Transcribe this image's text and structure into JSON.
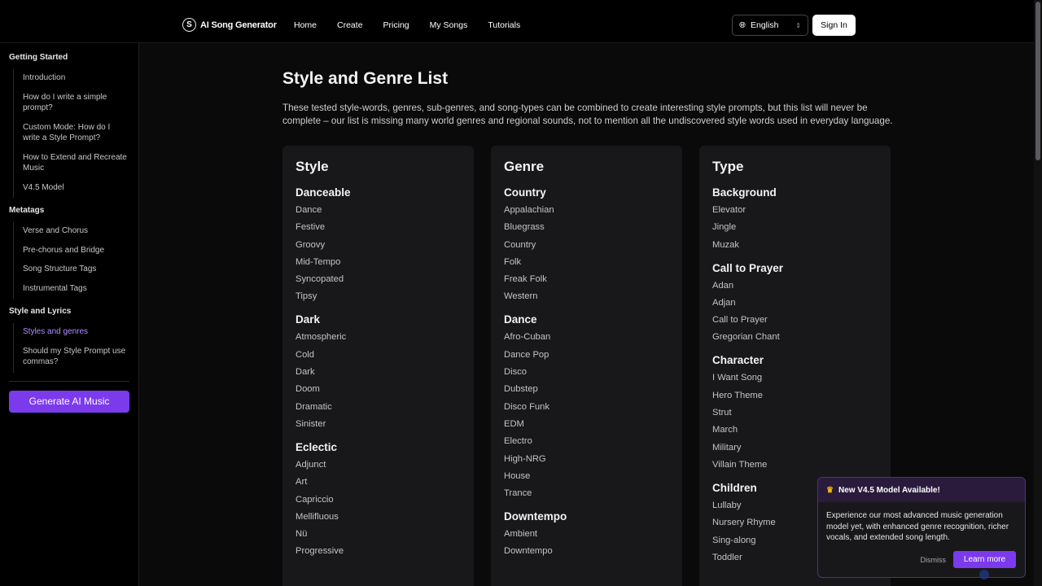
{
  "header": {
    "brand_logo": "S",
    "brand_name": "AI Song Generator",
    "nav": [
      "Home",
      "Create",
      "Pricing",
      "My Songs",
      "Tutorials"
    ],
    "language": "English",
    "sign_in": "Sign In"
  },
  "sidebar": {
    "sections": [
      {
        "title": "Getting Started",
        "items": [
          "Introduction",
          "How do I write a simple prompt?",
          "Custom Mode: How do I write a Style Prompt?",
          "How to Extend and Recreate Music",
          "V4.5 Model"
        ]
      },
      {
        "title": "Metatags",
        "items": [
          "Verse and Chorus",
          "Pre-chorus and Bridge",
          "Song Structure Tags",
          "Instrumental Tags"
        ]
      },
      {
        "title": "Style and Lyrics",
        "items": [
          "Styles and genres",
          "Should my Style Prompt use commas?"
        ]
      }
    ],
    "active_item": "Styles and genres",
    "generate_button": "Generate AI Music"
  },
  "main": {
    "title": "Style and Genre List",
    "intro": "These tested style-words, genres, sub-genres, and song-types can be combined to create interesting style prompts, but this list will never be complete – our list is missing many world genres and regional sounds, not to mention all the undiscovered style words used in everyday language.",
    "cards": [
      {
        "title": "Style",
        "groups": [
          {
            "title": "Danceable",
            "items": [
              "Dance",
              "Festive",
              "Groovy",
              "Mid-Tempo",
              "Syncopated",
              "Tipsy"
            ]
          },
          {
            "title": "Dark",
            "items": [
              "Atmospheric",
              "Cold",
              "Dark",
              "Doom",
              "Dramatic",
              "Sinister"
            ]
          },
          {
            "title": "Eclectic",
            "items": [
              "Adjunct",
              "Art",
              "Capriccio",
              "Mellifluous",
              "Nü",
              "Progressive"
            ]
          }
        ]
      },
      {
        "title": "Genre",
        "groups": [
          {
            "title": "Country",
            "items": [
              "Appalachian",
              "Bluegrass",
              "Country",
              "Folk",
              "Freak Folk",
              "Western"
            ]
          },
          {
            "title": "Dance",
            "items": [
              "Afro-Cuban",
              "Dance Pop",
              "Disco",
              "Dubstep",
              "Disco Funk",
              "EDM",
              "Electro",
              "High-NRG",
              "House",
              "Trance"
            ]
          },
          {
            "title": "Downtempo",
            "items": [
              "Ambient",
              "Downtempo"
            ]
          }
        ]
      },
      {
        "title": "Type",
        "groups": [
          {
            "title": "Background",
            "items": [
              "Elevator",
              "Jingle",
              "Muzak"
            ]
          },
          {
            "title": "Call to Prayer",
            "items": [
              "Adan",
              "Adjan",
              "Call to Prayer",
              "Gregorian Chant"
            ]
          },
          {
            "title": "Character",
            "items": [
              "I Want Song",
              "Hero Theme",
              "Strut",
              "March",
              "Military",
              "Villain Theme"
            ]
          },
          {
            "title": "Children",
            "items": [
              "Lullaby",
              "Nursery Rhyme",
              "Sing-along",
              "Toddler"
            ]
          }
        ]
      }
    ]
  },
  "popup": {
    "title": "New V4.5 Model Available!",
    "body": "Experience our most advanced music generation model yet, with enhanced genre recognition, richer vocals, and extended song length.",
    "dismiss": "Dismiss",
    "learn_more": "Learn more"
  },
  "icons": {
    "language": "globe-icon",
    "popup": "crown-icon",
    "lang_select": "chevron-updown-icon"
  },
  "colors": {
    "accent": "#7c3aed",
    "active_link": "#b48cff",
    "background": "#000000",
    "card": "#18181b"
  }
}
